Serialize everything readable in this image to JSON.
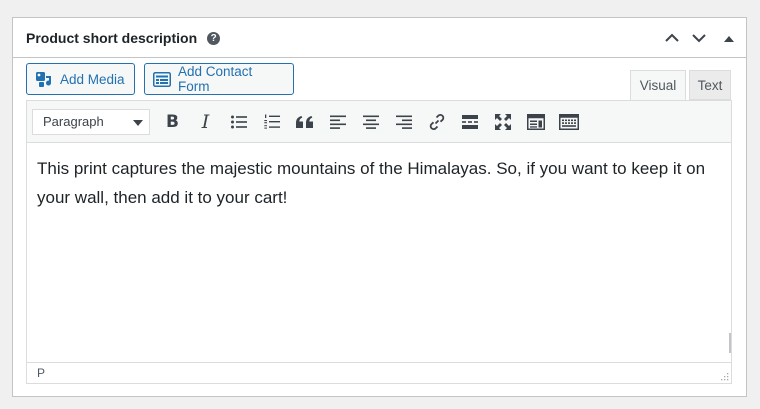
{
  "metabox": {
    "title": "Product short description",
    "help_icon": "question-mark-icon",
    "actions": [
      "move-up-icon",
      "move-down-icon",
      "toggle-panel-icon"
    ]
  },
  "media_buttons": {
    "add_media": "Add Media",
    "add_contact_form": "Add Contact Form"
  },
  "tabs": {
    "visual": "Visual",
    "text": "Text"
  },
  "toolbar": {
    "format_select": "Paragraph",
    "bold": "B",
    "italic": "I",
    "buttons": [
      "bold-icon",
      "italic-icon",
      "bullet-list-icon",
      "numbered-list-icon",
      "blockquote-icon",
      "align-left-icon",
      "align-center-icon",
      "align-right-icon",
      "link-icon",
      "read-more-icon",
      "fullscreen-icon",
      "toolbar-toggle-icon",
      "keyboard-icon"
    ]
  },
  "content": {
    "text": "This print captures the majestic mountains of the Himalayas. So, if you want to keep it on your wall, then add it to your cart!"
  },
  "statusbar": {
    "path": "P"
  },
  "colors": {
    "accent": "#2271b1",
    "border": "#c3c4c7",
    "toolbar_bg": "#f6f7f7",
    "page_bg": "#f0f0f1"
  }
}
